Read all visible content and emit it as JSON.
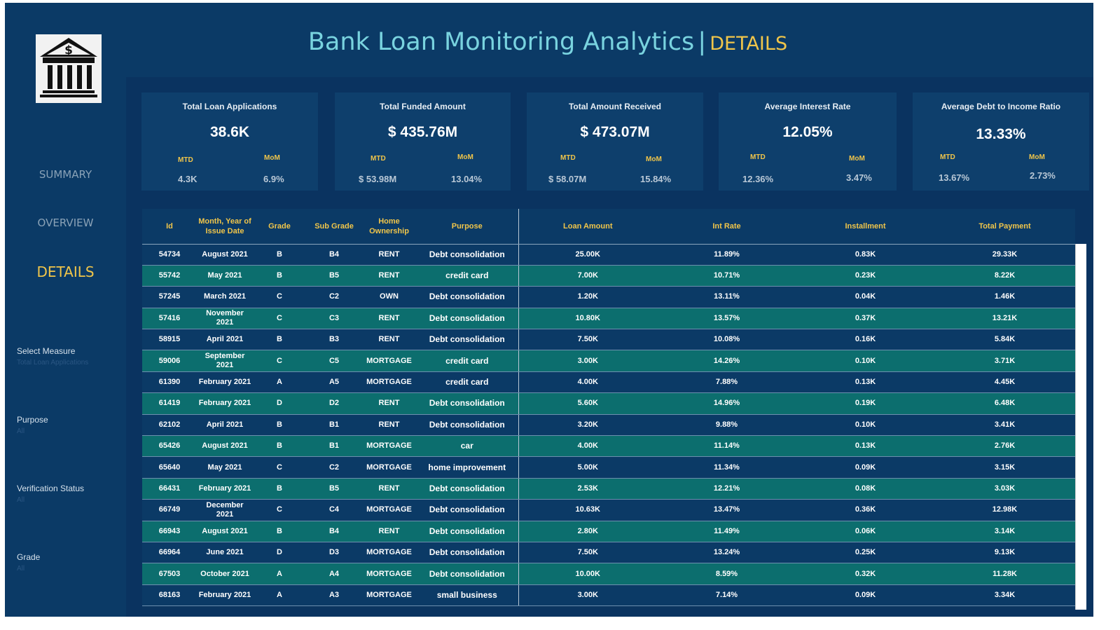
{
  "header": {
    "title_main": "Bank Loan Monitoring Analytics",
    "title_separator": "|",
    "title_sub": "DETAILS"
  },
  "sidebar": {
    "logo_icon": "bank-building-dollar-icon",
    "nav": [
      {
        "label": "SUMMARY",
        "active": false
      },
      {
        "label": "OVERVIEW",
        "active": false
      },
      {
        "label": "DETAILS",
        "active": true
      }
    ],
    "filters": [
      {
        "label": "Select Measure",
        "value": "Total Loan Applications"
      },
      {
        "label": "Purpose",
        "value": "All"
      },
      {
        "label": "Verification Status",
        "value": "All"
      },
      {
        "label": "Grade",
        "value": "All"
      }
    ]
  },
  "kpis": [
    {
      "title": "Total Loan Applications",
      "value": "38.6K",
      "mtd_label": "MTD",
      "mom_label": "MoM",
      "mtd": "4.3K",
      "mom": "6.9%"
    },
    {
      "title": "Total Funded Amount",
      "value": "$ 435.76M",
      "mtd_label": "MTD",
      "mom_label": "MoM",
      "mtd": "$ 53.98M",
      "mom": "13.04%"
    },
    {
      "title": "Total Amount Received",
      "value": "$ 473.07M",
      "mtd_label": "MTD",
      "mom_label": "MoM",
      "mtd": "$ 58.07M",
      "mom": "15.84%"
    },
    {
      "title": "Average Interest Rate",
      "value": "12.05%",
      "mtd_label": "MTD",
      "mom_label": "MoM",
      "mtd": "12.36%",
      "mom": "3.47%"
    },
    {
      "title": "Average Debt to Income Ratio",
      "value": "13.33%",
      "mtd_label": "MTD",
      "mom_label": "MoM",
      "mtd": "13.67%",
      "mom": "2.73%"
    }
  ],
  "table": {
    "columns": [
      "Id",
      "Month, Year of Issue Date",
      "Grade",
      "Sub Grade",
      "Home Ownership",
      "Purpose",
      "Loan Amount",
      "Int Rate",
      "Installment",
      "Total Payment"
    ],
    "rows": [
      [
        "54734",
        "August 2021",
        "B",
        "B4",
        "RENT",
        "Debt consolidation",
        "25.00K",
        "11.89%",
        "0.83K",
        "29.33K"
      ],
      [
        "55742",
        "May 2021",
        "B",
        "B5",
        "RENT",
        "credit card",
        "7.00K",
        "10.71%",
        "0.23K",
        "8.22K"
      ],
      [
        "57245",
        "March 2021",
        "C",
        "C2",
        "OWN",
        "Debt consolidation",
        "1.20K",
        "13.11%",
        "0.04K",
        "1.46K"
      ],
      [
        "57416",
        "November 2021",
        "C",
        "C3",
        "RENT",
        "Debt consolidation",
        "10.80K",
        "13.57%",
        "0.37K",
        "13.21K"
      ],
      [
        "58915",
        "April 2021",
        "B",
        "B3",
        "RENT",
        "Debt consolidation",
        "7.50K",
        "10.08%",
        "0.16K",
        "5.84K"
      ],
      [
        "59006",
        "September 2021",
        "C",
        "C5",
        "MORTGAGE",
        "credit card",
        "3.00K",
        "14.26%",
        "0.10K",
        "3.71K"
      ],
      [
        "61390",
        "February 2021",
        "A",
        "A5",
        "MORTGAGE",
        "credit card",
        "4.00K",
        "7.88%",
        "0.13K",
        "4.45K"
      ],
      [
        "61419",
        "February 2021",
        "D",
        "D2",
        "RENT",
        "Debt consolidation",
        "5.60K",
        "14.96%",
        "0.19K",
        "6.48K"
      ],
      [
        "62102",
        "April 2021",
        "B",
        "B1",
        "RENT",
        "Debt consolidation",
        "3.20K",
        "9.88%",
        "0.10K",
        "3.41K"
      ],
      [
        "65426",
        "August 2021",
        "B",
        "B1",
        "MORTGAGE",
        "car",
        "4.00K",
        "11.14%",
        "0.13K",
        "2.76K"
      ],
      [
        "65640",
        "May 2021",
        "C",
        "C2",
        "MORTGAGE",
        "home improvement",
        "5.00K",
        "11.34%",
        "0.09K",
        "3.15K"
      ],
      [
        "66431",
        "February 2021",
        "B",
        "B5",
        "RENT",
        "Debt consolidation",
        "2.53K",
        "12.21%",
        "0.08K",
        "3.03K"
      ],
      [
        "66749",
        "December 2021",
        "C",
        "C4",
        "MORTGAGE",
        "Debt consolidation",
        "10.63K",
        "13.47%",
        "0.36K",
        "12.98K"
      ],
      [
        "66943",
        "August 2021",
        "B",
        "B4",
        "RENT",
        "Debt consolidation",
        "2.80K",
        "11.49%",
        "0.06K",
        "3.14K"
      ],
      [
        "66964",
        "June 2021",
        "D",
        "D3",
        "MORTGAGE",
        "Debt consolidation",
        "7.50K",
        "13.24%",
        "0.25K",
        "9.13K"
      ],
      [
        "67503",
        "October 2021",
        "A",
        "A4",
        "MORTGAGE",
        "Debt consolidation",
        "10.00K",
        "8.59%",
        "0.32K",
        "11.28K"
      ],
      [
        "68163",
        "February 2021",
        "A",
        "A3",
        "MORTGAGE",
        "small business",
        "3.00K",
        "7.14%",
        "0.09K",
        "3.34K"
      ]
    ]
  },
  "colors": {
    "background": "#0b2f5c",
    "panel": "#0b3a66",
    "row_alt": "#0c6e6e",
    "title": "#79d3df",
    "accent": "#f0c54a"
  }
}
